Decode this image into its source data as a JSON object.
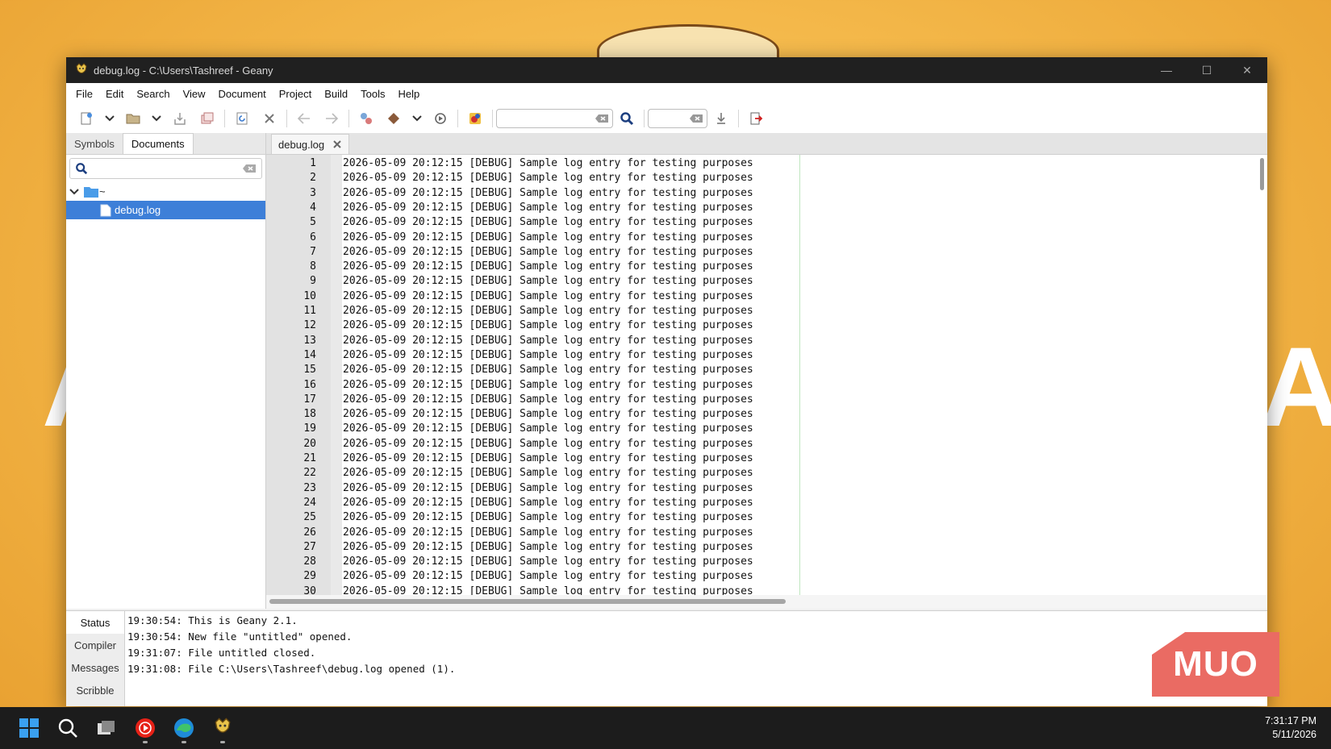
{
  "window": {
    "title": "debug.log - C:\\Users\\Tashreef - Geany",
    "controls": {
      "minimize": "—",
      "maximize": "☐",
      "close": "✕"
    }
  },
  "menu": [
    "File",
    "Edit",
    "Search",
    "View",
    "Document",
    "Project",
    "Build",
    "Tools",
    "Help"
  ],
  "toolbar": {
    "search_value": "",
    "goto_line_value": ""
  },
  "sidebar": {
    "tabs": [
      "Symbols",
      "Documents"
    ],
    "active_tab": "Documents",
    "filter_value": "",
    "folder_label": "~",
    "file_label": "debug.log"
  },
  "editor": {
    "tab_label": "debug.log",
    "lines": [
      "2026-05-09 20:12:15 [DEBUG] Sample log entry for testing purposes",
      "2026-05-09 20:12:15 [DEBUG] Sample log entry for testing purposes",
      "2026-05-09 20:12:15 [DEBUG] Sample log entry for testing purposes",
      "2026-05-09 20:12:15 [DEBUG] Sample log entry for testing purposes",
      "2026-05-09 20:12:15 [DEBUG] Sample log entry for testing purposes",
      "2026-05-09 20:12:15 [DEBUG] Sample log entry for testing purposes",
      "2026-05-09 20:12:15 [DEBUG] Sample log entry for testing purposes",
      "2026-05-09 20:12:15 [DEBUG] Sample log entry for testing purposes",
      "2026-05-09 20:12:15 [DEBUG] Sample log entry for testing purposes",
      "2026-05-09 20:12:15 [DEBUG] Sample log entry for testing purposes",
      "2026-05-09 20:12:15 [DEBUG] Sample log entry for testing purposes",
      "2026-05-09 20:12:15 [DEBUG] Sample log entry for testing purposes",
      "2026-05-09 20:12:15 [DEBUG] Sample log entry for testing purposes",
      "2026-05-09 20:12:15 [DEBUG] Sample log entry for testing purposes",
      "2026-05-09 20:12:15 [DEBUG] Sample log entry for testing purposes",
      "2026-05-09 20:12:15 [DEBUG] Sample log entry for testing purposes",
      "2026-05-09 20:12:15 [DEBUG] Sample log entry for testing purposes",
      "2026-05-09 20:12:15 [DEBUG] Sample log entry for testing purposes",
      "2026-05-09 20:12:15 [DEBUG] Sample log entry for testing purposes",
      "2026-05-09 20:12:15 [DEBUG] Sample log entry for testing purposes",
      "2026-05-09 20:12:15 [DEBUG] Sample log entry for testing purposes",
      "2026-05-09 20:12:15 [DEBUG] Sample log entry for testing purposes",
      "2026-05-09 20:12:15 [DEBUG] Sample log entry for testing purposes",
      "2026-05-09 20:12:15 [DEBUG] Sample log entry for testing purposes",
      "2026-05-09 20:12:15 [DEBUG] Sample log entry for testing purposes",
      "2026-05-09 20:12:15 [DEBUG] Sample log entry for testing purposes",
      "2026-05-09 20:12:15 [DEBUG] Sample log entry for testing purposes",
      "2026-05-09 20:12:15 [DEBUG] Sample log entry for testing purposes",
      "2026-05-09 20:12:15 [DEBUG] Sample log entry for testing purposes",
      "2026-05-09 20:12:15 [DEBUG] Sample log entry for testing purposes"
    ]
  },
  "messages": {
    "tabs": [
      "Status",
      "Compiler",
      "Messages",
      "Scribble"
    ],
    "active_tab": "Status",
    "lines": [
      "19:30:54: This is Geany 2.1.",
      "19:30:54: New file \"untitled\" opened.",
      "19:31:07: File untitled closed.",
      "19:31:08: File C:\\Users\\Tashreef\\debug.log opened (1)."
    ]
  },
  "taskbar": {
    "apps": [
      "start-icon",
      "search-icon",
      "task-view-icon",
      "youtube-music-icon",
      "edge-icon",
      "geany-icon"
    ],
    "time": "7:31:17 PM",
    "date": "5/11/2026"
  },
  "watermark": "MUO",
  "colors": {
    "selection": "#3d7fd8",
    "titlebar": "#202020",
    "taskbar": "#1c1c1c",
    "watermark": "#ea6b63"
  }
}
